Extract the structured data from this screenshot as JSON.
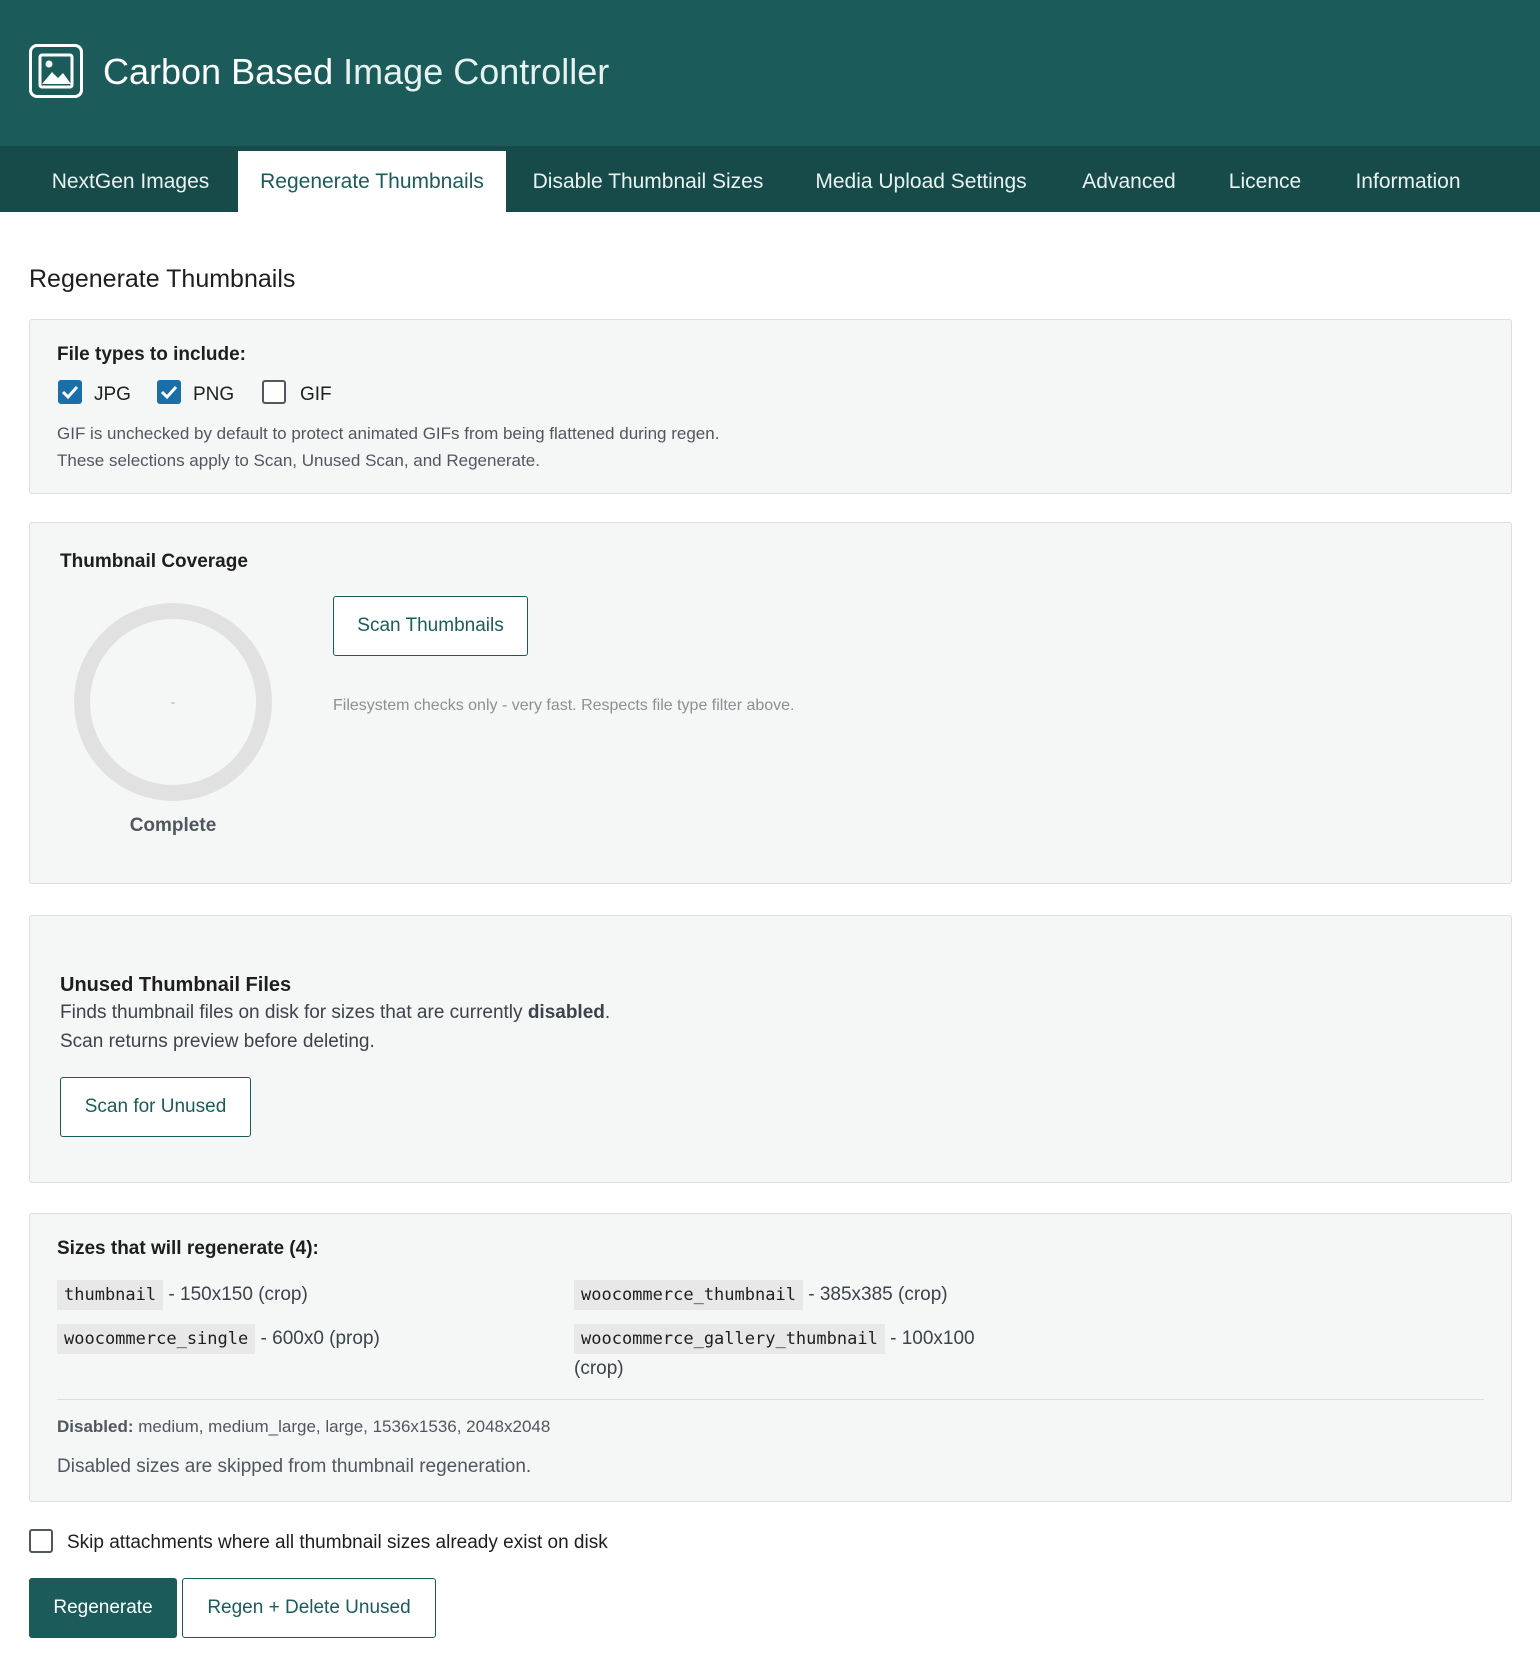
{
  "app": {
    "title_bold": "Carbon Based",
    "title_light": "Image Controller",
    "logo_icon": "image-icon"
  },
  "tabs": [
    {
      "label": "NextGen Images",
      "active": false
    },
    {
      "label": "Regenerate Thumbnails",
      "active": true
    },
    {
      "label": "Disable Thumbnail Sizes",
      "active": false
    },
    {
      "label": "Media Upload Settings",
      "active": false
    },
    {
      "label": "Advanced",
      "active": false
    },
    {
      "label": "Licence",
      "active": false
    },
    {
      "label": "Information",
      "active": false
    }
  ],
  "page": {
    "title": "Regenerate Thumbnails"
  },
  "file_types": {
    "heading": "File types to include:",
    "options": [
      {
        "label": "JPG",
        "checked": true
      },
      {
        "label": "PNG",
        "checked": true
      },
      {
        "label": "GIF",
        "checked": false
      }
    ],
    "note1": "GIF is unchecked by default to protect animated GIFs from being flattened during regen.",
    "note2": "These selections apply to Scan, Unused Scan, and Regenerate."
  },
  "coverage": {
    "heading": "Thumbnail Coverage",
    "ring_value": "-",
    "ring_label": "Complete",
    "scan_button": "Scan Thumbnails",
    "scan_note": "Filesystem checks only - very fast. Respects file type filter above."
  },
  "unused": {
    "heading": "Unused Thumbnail Files",
    "desc_prefix": "Finds thumbnail files on disk for sizes that are currently ",
    "desc_bold": "disabled",
    "desc_suffix": ".",
    "desc2": "Scan returns preview before deleting.",
    "button": "Scan for Unused"
  },
  "sizes": {
    "heading": "Sizes that will regenerate (4):",
    "items": [
      {
        "name": "thumbnail",
        "desc": "- 150x150 (crop)"
      },
      {
        "name": "woocommerce_thumbnail",
        "desc": "- 385x385 (crop)"
      },
      {
        "name": "woocommerce_single",
        "desc": "- 600x0 (prop)"
      },
      {
        "name": "woocommerce_gallery_thumbnail",
        "desc": "- 100x100",
        "desc_wrap": "(crop)"
      }
    ],
    "disabled_label": "Disabled:",
    "disabled_list": "medium, medium_large, large, 1536x1536, 2048x2048",
    "disabled_note": "Disabled sizes are skipped from thumbnail regeneration."
  },
  "footer": {
    "skip_label": "Skip attachments where all thumbnail sizes already exist on disk",
    "skip_checked": false,
    "regenerate_button": "Regenerate",
    "regen_delete_button": "Regen + Delete Unused"
  },
  "colors": {
    "brand": "#1b5c5a",
    "tabbar": "#174b49",
    "checkbox": "#1b6fa8"
  }
}
